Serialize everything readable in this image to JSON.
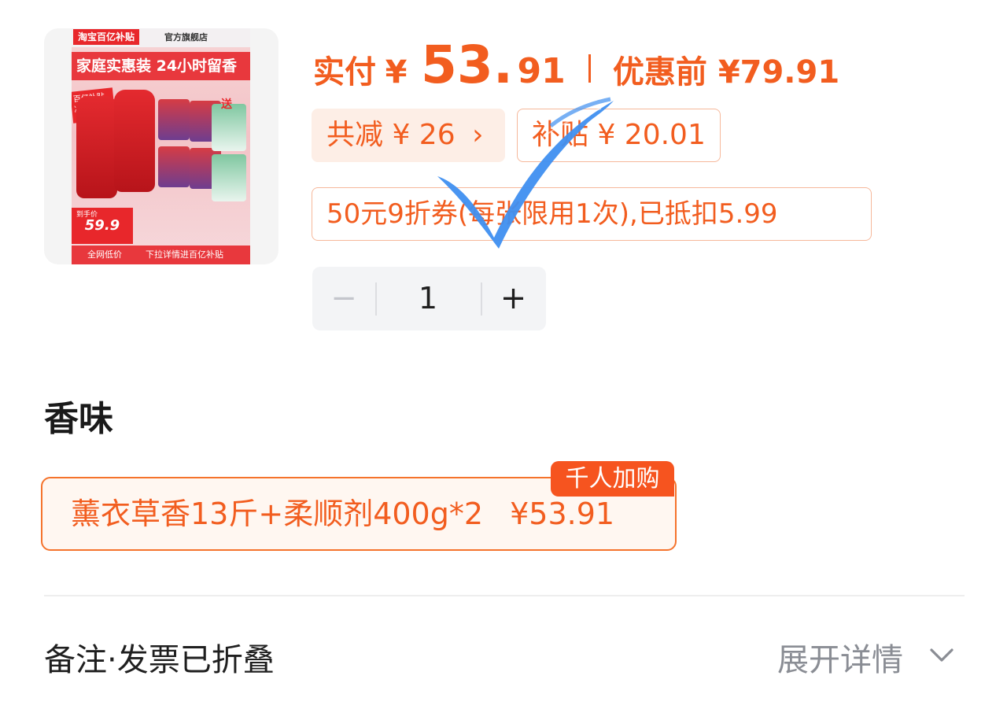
{
  "product": {
    "image": {
      "badge": "淘宝百亿补贴",
      "store": "官方旗舰店",
      "headline": "家庭实惠装 24小时留香",
      "subsidy": "百亿补贴 减20.01",
      "gift": "送",
      "price_label": "到手价",
      "price": "59.9",
      "foot_left": "全网低价",
      "foot_right": "下拉详情进百亿补贴"
    }
  },
  "price": {
    "pay_label": "实付",
    "yen": "¥",
    "pay_int": "53.",
    "pay_dec": "91",
    "original": "优惠前 ¥79.91"
  },
  "discounts": {
    "total": "共减 ¥ 26",
    "total_chevron": "›",
    "subsidy": "补贴 ¥ 20.01",
    "coupon": "50元9折券(每张限用1次),已抵扣5.99"
  },
  "quantity": {
    "minus": "−",
    "value": "1",
    "plus": "+"
  },
  "scent": {
    "title": "香味",
    "option_label": "薰衣草香13斤+柔顺剂400g*2",
    "option_price": "¥53.91",
    "tag": "千人加购"
  },
  "remark": {
    "label": "备注·发票已折叠",
    "expand": "展开详情"
  },
  "colors": {
    "accent": "#f25d1f",
    "tag": "#f6541f",
    "check": "#3f8ff0"
  },
  "icons": {
    "check": "checkmark-icon",
    "chevron": "chevron-down-icon"
  }
}
